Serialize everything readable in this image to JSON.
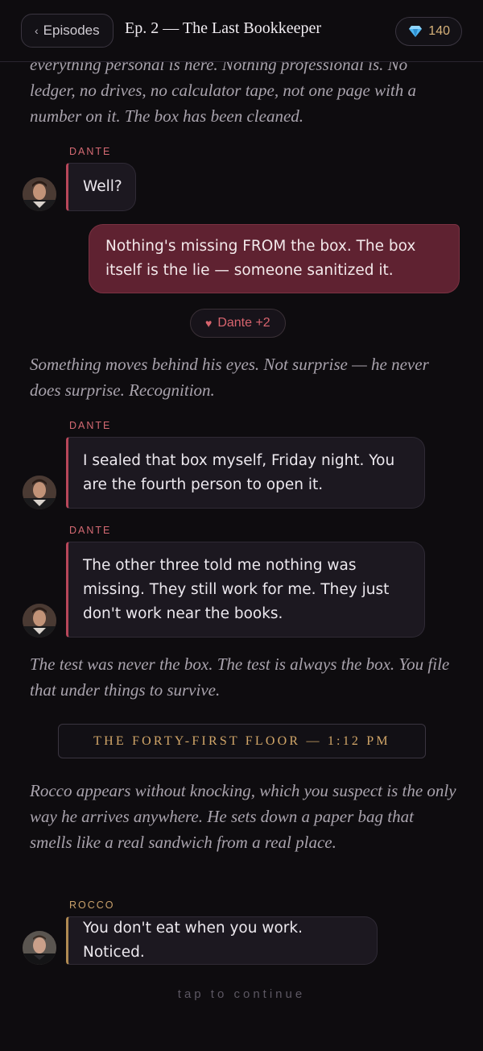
{
  "header": {
    "back_label": "Episodes",
    "episode_title": "Ep. 2 — The Last Bookkeeper",
    "gem_count": "140"
  },
  "story": {
    "narration_1": "everything personal is here. Nothing professional is. No ledger, no drives, no calculator tape, not one page with a number on it. The box has been cleaned.",
    "msg_1_speaker": "DANTE",
    "msg_1_text": "Well?",
    "player_reply": "Nothing's missing FROM the box. The box itself is the lie — someone sanitized it.",
    "affinity_label": "Dante +2",
    "narration_2": "Something moves behind his eyes. Not surprise — he never does surprise. Recognition.",
    "msg_2_speaker": "DANTE",
    "msg_2_text": "I sealed that box myself, Friday night. You are the fourth person to open it.",
    "msg_3_speaker": "DANTE",
    "msg_3_text": "The other three told me nothing was missing. They still work for me. They just don't work near the books.",
    "narration_3": "The test was never the box. The test is always the box. You file that under things to survive.",
    "scene_card": "THE FORTY-FIRST FLOOR — 1:12 PM",
    "narration_4": "Rocco appears without knocking, which you suspect is the only way he arrives anywhere. He sets down a paper bag that smells like a real sandwich from a real place.",
    "msg_4_speaker": "ROCCO",
    "msg_4_text": "You don't eat when you work. Noticed.",
    "continue_hint": "tap to continue"
  },
  "colors": {
    "background": "#0e0c0f",
    "dante_accent": "#d56a73",
    "rocco_accent": "#c9a16b",
    "player_bubble": "#5f2231",
    "gem_text": "#d7b27a"
  },
  "icons": {
    "back": "chevron-left-icon",
    "currency": "gem-icon",
    "affinity": "heart-icon"
  }
}
